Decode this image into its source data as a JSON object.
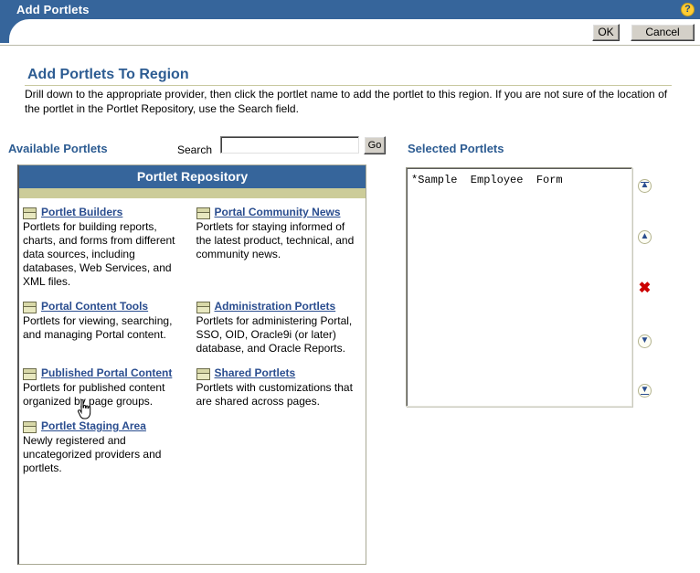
{
  "window": {
    "title": "Add Portlets",
    "help_icon_label": "?"
  },
  "toolbar": {
    "ok_label": "OK",
    "cancel_label": "Cancel"
  },
  "page": {
    "heading": "Add Portlets To Region",
    "description": "Drill down to the appropriate provider, then click the portlet name to add the portlet to this region. If you are not sure of the location of the portlet in the Portlet Repository, use the Search field."
  },
  "sections": {
    "available_label": "Available Portlets",
    "selected_label": "Selected Portlets"
  },
  "search": {
    "label": "Search",
    "value": "",
    "placeholder": "",
    "go_label": "Go"
  },
  "repository": {
    "header": "Portlet Repository",
    "items": [
      {
        "name": "Portlet Builders",
        "description": "Portlets for building reports, charts, and forms from different data sources, including databases, Web Services, and XML files."
      },
      {
        "name": "Portal Community News",
        "description": "Portlets for staying informed of the latest product, technical, and community news."
      },
      {
        "name": "Portal Content Tools",
        "description": "Portlets for viewing, searching, and managing Portal content."
      },
      {
        "name": "Administration Portlets",
        "description": "Portlets for administering Portal, SSO, OID, Oracle9i (or later) database, and Oracle Reports."
      },
      {
        "name": "Published Portal Content",
        "description": "Portlets for published content organized by page groups."
      },
      {
        "name": "Shared Portlets",
        "description": "Portlets with customizations that are shared across pages."
      },
      {
        "name": "Portlet Staging Area",
        "description": "Newly registered and uncategorized providers and portlets."
      }
    ]
  },
  "selected_portlets": {
    "items": [
      "*Sample  Employee  Form"
    ]
  },
  "actions": [
    {
      "id": "move-to-top",
      "glyph": "▲"
    },
    {
      "id": "move-up",
      "glyph": "▲"
    },
    {
      "id": "delete",
      "glyph": "✖"
    },
    {
      "id": "move-down",
      "glyph": "▼"
    },
    {
      "id": "move-to-bottom",
      "glyph": "▼"
    }
  ],
  "colors": {
    "title_blue": "#36659b",
    "khaki": "#cccc99",
    "link_blue": "#2a4d8f",
    "heading_blue": "#2d5c92",
    "delete_red": "#cc0000",
    "help_yellow": "#ffcc33"
  }
}
